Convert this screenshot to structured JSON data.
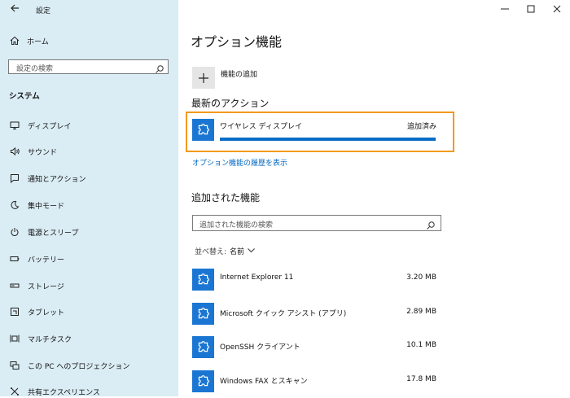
{
  "window": {
    "title": "設定",
    "back_icon": "back-arrow-icon",
    "buttons": [
      "minimize-icon",
      "maximize-icon",
      "close-icon"
    ]
  },
  "sidebar": {
    "home_label": "ホーム",
    "search_placeholder": "設定の検索",
    "section": "システム",
    "items": [
      {
        "label": "ディスプレイ",
        "icon": "monitor-icon"
      },
      {
        "label": "サウンド",
        "icon": "speaker-icon"
      },
      {
        "label": "通知とアクション",
        "icon": "notification-icon"
      },
      {
        "label": "集中モード",
        "icon": "moon-icon"
      },
      {
        "label": "電源とスリープ",
        "icon": "power-icon"
      },
      {
        "label": "バッテリー",
        "icon": "battery-icon"
      },
      {
        "label": "ストレージ",
        "icon": "storage-icon"
      },
      {
        "label": "タブレット",
        "icon": "tablet-icon"
      },
      {
        "label": "マルチタスク",
        "icon": "multitask-icon"
      },
      {
        "label": "この PC へのプロジェクション",
        "icon": "projection-icon"
      },
      {
        "label": "共有エクスペリエンス",
        "icon": "shared-experience-icon"
      }
    ]
  },
  "main": {
    "title": "オプション機能",
    "add_feature_label": "機能の追加",
    "recent_heading": "最新のアクション",
    "recent_action": {
      "name": "ワイヤレス ディスプレイ",
      "status": "追加済み",
      "progress": 1.0
    },
    "history_link": "オプション機能の履歴を表示",
    "installed_heading": "追加された機能",
    "installed_search_placeholder": "追加された機能の検索",
    "sort_label": "並べ替え:",
    "sort_value": "名前",
    "features": [
      {
        "name": "Internet Explorer 11",
        "size": "3.20 MB"
      },
      {
        "name": "Microsoft クイック アシスト (アプリ)",
        "size": "2.89 MB"
      },
      {
        "name": "OpenSSH クライアント",
        "size": "10.1 MB"
      },
      {
        "name": "Windows FAX とスキャン",
        "size": "17.8 MB"
      }
    ]
  },
  "colors": {
    "sidebar_bg": "#daecf4",
    "accent": "#1a76d2",
    "highlight_border": "#f29a1e",
    "link": "#0067c0"
  }
}
